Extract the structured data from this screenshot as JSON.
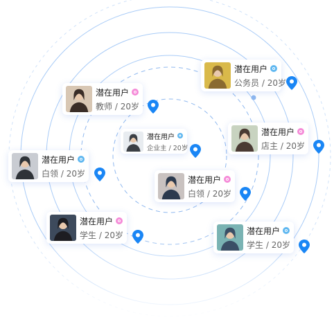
{
  "colors": {
    "ring": "#9ec6f7",
    "ring_dashed": "#8fb8ef",
    "pin": "#1a86f5",
    "badge_male": "#5fb7f0",
    "badge_female": "#f58bd8"
  },
  "cards": [
    {
      "id": "card-1",
      "name": "潜在用户",
      "badge": "male",
      "role": "公务员",
      "age": "20岁",
      "avatar_tone": [
        "#d9b94a",
        "#8a6a30"
      ]
    },
    {
      "id": "card-2",
      "name": "潜在用户",
      "badge": "female",
      "role": "教师",
      "age": "20岁",
      "avatar_tone": [
        "#d8c7b4",
        "#3a2d27"
      ]
    },
    {
      "id": "card-3",
      "name": "潜在用户",
      "badge": "male",
      "role": "企业主",
      "age": "20岁",
      "avatar_tone": [
        "#e8ecf0",
        "#3b3f45"
      ]
    },
    {
      "id": "card-4",
      "name": "潜在用户",
      "badge": "female",
      "role": "店主",
      "age": "20岁",
      "avatar_tone": [
        "#c8d3c0",
        "#4a3a33"
      ]
    },
    {
      "id": "card-5",
      "name": "潜在用户",
      "badge": "male",
      "role": "白领",
      "age": "20岁",
      "avatar_tone": [
        "#c9ccd2",
        "#2f3338"
      ]
    },
    {
      "id": "card-6",
      "name": "潜在用户",
      "badge": "female",
      "role": "白领",
      "age": "20岁",
      "avatar_tone": [
        "#c9c2c0",
        "#2c3a4e"
      ]
    },
    {
      "id": "card-7",
      "name": "潜在用户",
      "badge": "female",
      "role": "学生",
      "age": "20岁",
      "avatar_tone": [
        "#3d4a5c",
        "#1d1d22"
      ]
    },
    {
      "id": "card-8",
      "name": "潜在用户",
      "badge": "male",
      "role": "学生",
      "age": "20岁",
      "avatar_tone": [
        "#7ab3b3",
        "#3a4f66"
      ]
    }
  ],
  "pin_icon": "location-pin-icon"
}
